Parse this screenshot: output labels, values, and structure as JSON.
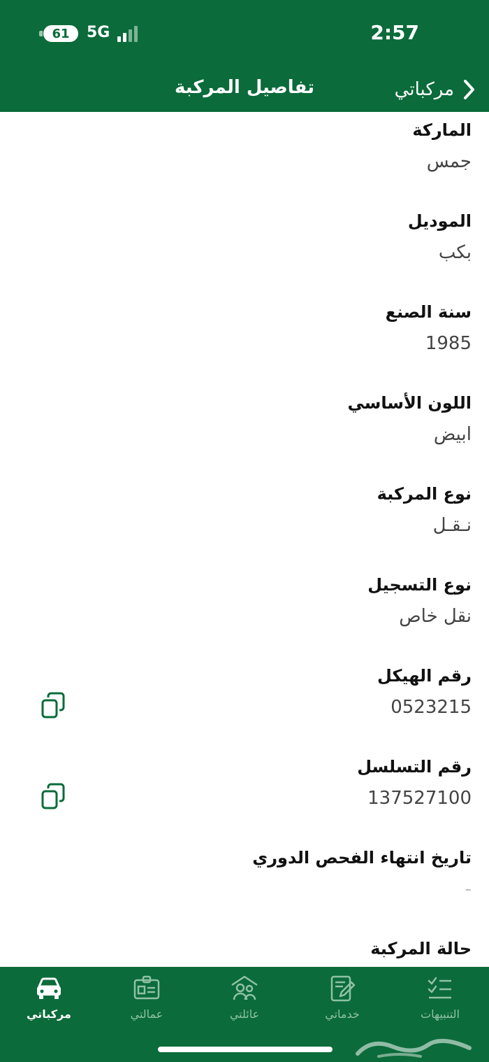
{
  "status_bar": {
    "battery": "61",
    "network": "5G",
    "time": "2:57"
  },
  "nav": {
    "title": "تفاصيل المركبة",
    "back_label": "مركباتي"
  },
  "fields": [
    {
      "label": "الماركة",
      "value": "جمس",
      "copyable": false
    },
    {
      "label": "الموديل",
      "value": "بكب",
      "copyable": false
    },
    {
      "label": "سنة الصنع",
      "value": "1985",
      "copyable": false
    },
    {
      "label": "اللون الأساسي",
      "value": "ابيض",
      "copyable": false
    },
    {
      "label": "نوع المركبة",
      "value": "نـقـل",
      "copyable": false
    },
    {
      "label": "نوع التسجيل",
      "value": "نقل خاص",
      "copyable": false
    },
    {
      "label": "رقم الهيكل",
      "value": "0523215",
      "copyable": true
    },
    {
      "label": "رقم التسلسل",
      "value": "137527100",
      "copyable": true
    },
    {
      "label": "تاريخ انتهاء الفحص الدوري",
      "value": "-",
      "copyable": false
    },
    {
      "label": "حالة المركبة",
      "value": "",
      "copyable": false
    }
  ],
  "tabs": [
    {
      "label": "مركباتي",
      "icon": "car-icon",
      "active": true
    },
    {
      "label": "عمالتي",
      "icon": "id-card-icon",
      "active": false
    },
    {
      "label": "عائلتي",
      "icon": "family-icon",
      "active": false
    },
    {
      "label": "خدماتي",
      "icon": "services-icon",
      "active": false
    },
    {
      "label": "التنبيهات",
      "icon": "checklist-icon",
      "active": false
    }
  ],
  "colors": {
    "brand_green": "#0b6b3a",
    "inactive_tab": "#8fc2a4"
  }
}
